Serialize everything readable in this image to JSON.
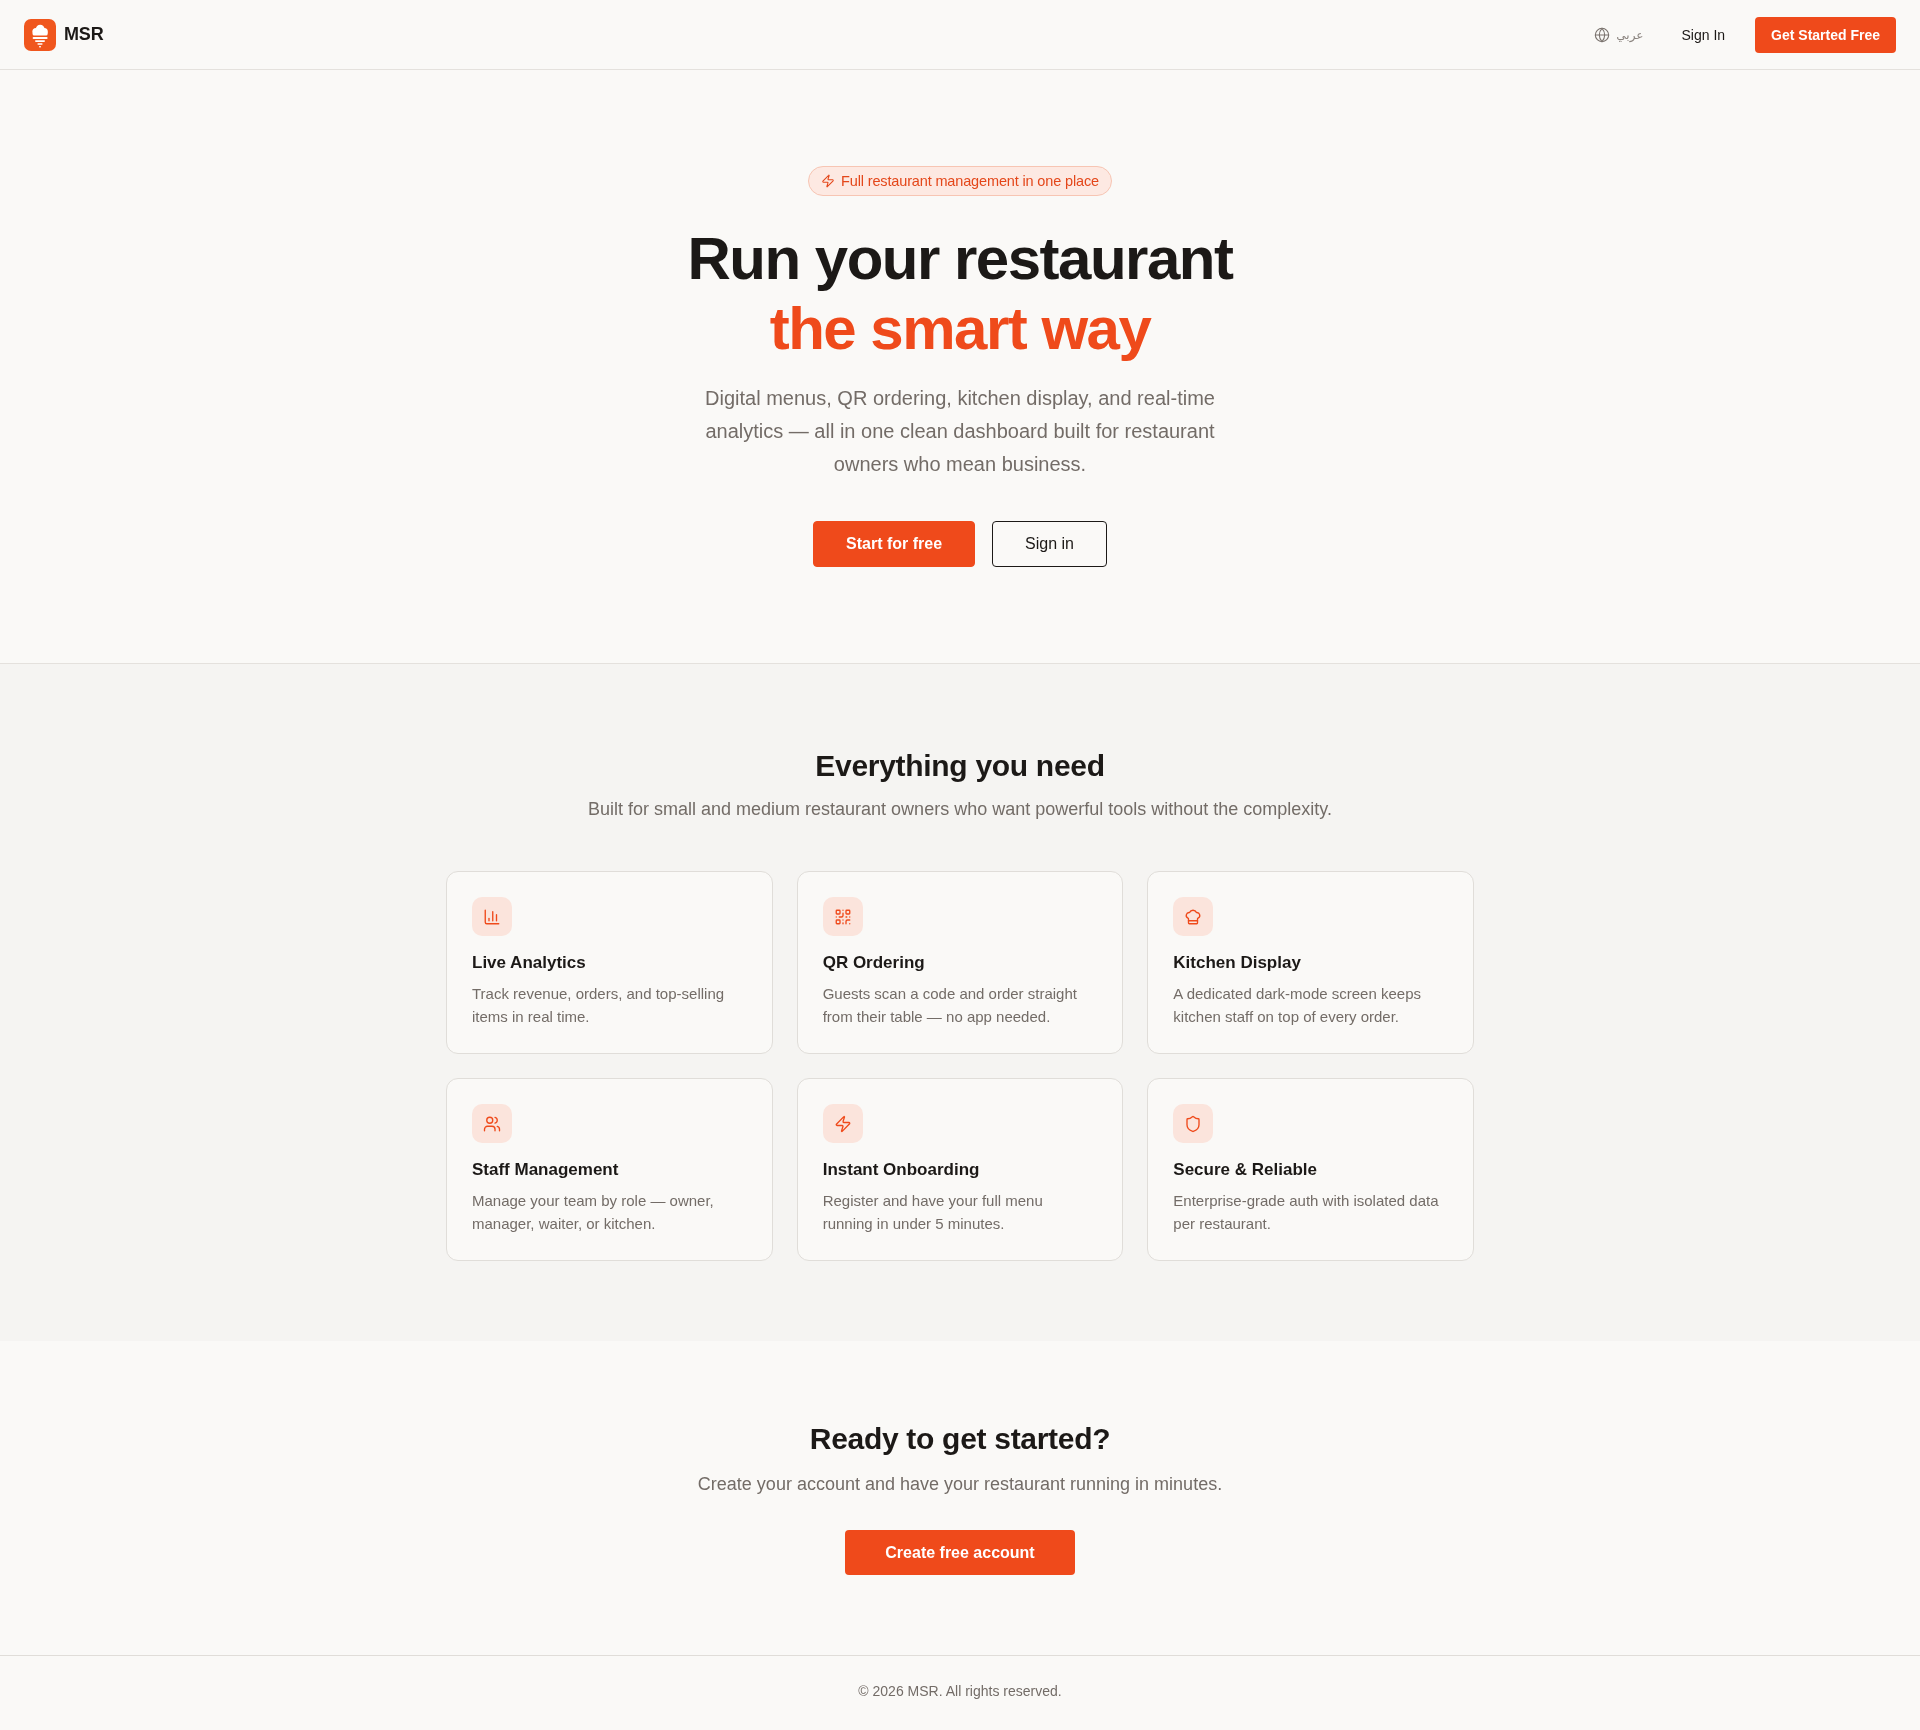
{
  "header": {
    "logo": "MSR",
    "language": "عربي",
    "sign_in": "Sign In",
    "cta": "Get Started Free"
  },
  "hero": {
    "badge": "Full restaurant management in one place",
    "title": "Run your restaurant",
    "title_highlight": "the smart way",
    "description": "Digital menus, QR ordering, kitchen display, and real-time analytics — all in one clean dashboard built for restaurant owners who mean business.",
    "buttons": [
      {
        "label": "Start for free",
        "kind": "primary"
      },
      {
        "label": "Sign in",
        "kind": "outline"
      }
    ]
  },
  "features": {
    "title": "Everything you need",
    "subtitle": "Built for small and medium restaurant owners who want powerful tools without the complexity.",
    "items": [
      {
        "title": "Live Analytics",
        "description": "Track revenue, orders, and top-selling items in real time."
      },
      {
        "title": "QR Ordering",
        "description": "Guests scan a code and order straight from their table — no app needed."
      },
      {
        "title": "Kitchen Display",
        "description": "A dedicated dark-mode screen keeps kitchen staff on top of every order."
      },
      {
        "title": "Staff Management",
        "description": "Manage your team by role — owner, manager, waiter, or kitchen."
      },
      {
        "title": "Instant Onboarding",
        "description": "Register and have your full menu running in under 5 minutes."
      },
      {
        "title": "Secure & Reliable",
        "description": "Enterprise-grade auth with isolated data per restaurant."
      }
    ]
  },
  "cta": {
    "title": "Ready to get started?",
    "subtitle": "Create your account and have your restaurant running in minutes.",
    "button": "Create free account"
  },
  "footer": {
    "copyright": "© 2026 MSR. All rights reserved."
  }
}
